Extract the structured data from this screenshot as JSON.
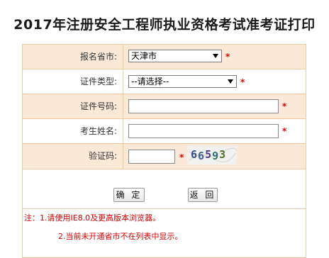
{
  "page": {
    "title": "2017年注册安全工程师执业资格考试准考证打印"
  },
  "form": {
    "province": {
      "label": "报名省市:",
      "value": "天津市",
      "required": "*"
    },
    "id_type": {
      "label": "证件类型:",
      "value": "--请选择--",
      "required": "*"
    },
    "id_number": {
      "label": "证件号码:",
      "value": "",
      "required": "*"
    },
    "name": {
      "label": "考生姓名:",
      "value": "",
      "required": "*"
    },
    "captcha": {
      "label": "验证码:",
      "value": "",
      "required": "*",
      "image_text": "66593"
    }
  },
  "buttons": {
    "confirm_label": "确 定",
    "back_label": "返 回"
  },
  "notes": {
    "line1": "注：1.请使用IE8.0及更高版本浏览器。",
    "line2": "2.当前未开通省市不在列表中显示。"
  },
  "colors": {
    "border": "#f0c9a4",
    "shade": "#fbe9d8",
    "required": "#e00000",
    "note_text": "#d40000"
  }
}
